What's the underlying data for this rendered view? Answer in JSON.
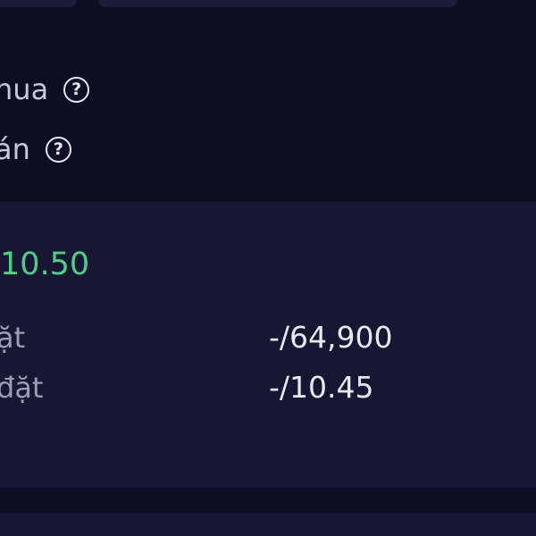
{
  "help_rows": {
    "buy_label": "nua",
    "sell_label": "án",
    "help_glyph": "?"
  },
  "order": {
    "price": "10.50",
    "price_color": "#4ccf8a",
    "rows": [
      {
        "label": "ặt",
        "value": "-/64,900"
      },
      {
        "label": "đặt",
        "value": "-/10.45"
      }
    ]
  },
  "icons": [
    "question-circle-icon"
  ]
}
